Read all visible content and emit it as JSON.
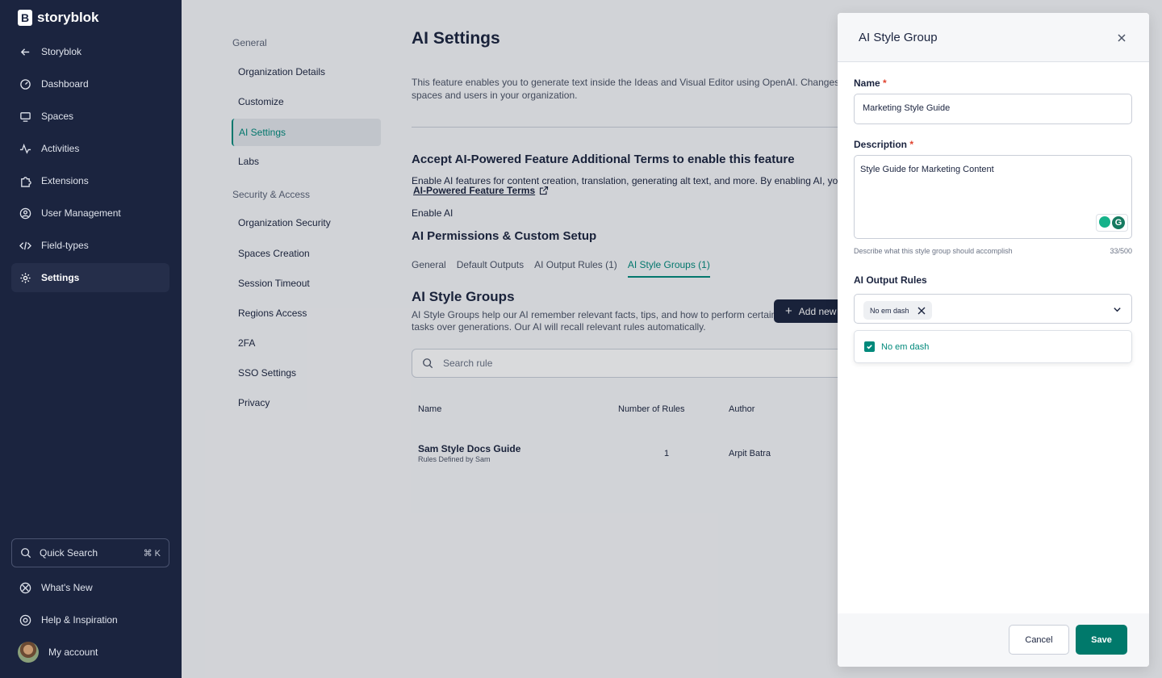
{
  "nav": {
    "brand": "storyblok",
    "items": [
      {
        "label": "Storyblok",
        "icon": "arrow-left-icon"
      },
      {
        "label": "Dashboard",
        "icon": "gauge-icon"
      },
      {
        "label": "Spaces",
        "icon": "monitor-icon"
      },
      {
        "label": "Activities",
        "icon": "activity-icon"
      },
      {
        "label": "Extensions",
        "icon": "puzzle-icon"
      },
      {
        "label": "User Management",
        "icon": "user-circle-icon"
      },
      {
        "label": "Field-types",
        "icon": "code-icon"
      },
      {
        "label": "Settings",
        "icon": "gear-icon"
      }
    ],
    "quick_search": "Quick Search",
    "quick_search_shortcut": "⌘ K",
    "whats_new": "What's New",
    "help": "Help & Inspiration",
    "account": "My account"
  },
  "settings_menu": {
    "general_heading": "General",
    "general_items": [
      "Organization Details",
      "Customize",
      "AI Settings",
      "Labs"
    ],
    "security_heading": "Security & Access",
    "security_items": [
      "Organization Security",
      "Spaces Creation",
      "Session Timeout",
      "Regions Access",
      "2FA",
      "SSO Settings",
      "Privacy"
    ]
  },
  "page": {
    "title": "AI Settings",
    "intro_line1": "This feature enables you to generate text inside the Ideas and Visual Editor using OpenAI. Changes here aff",
    "intro_line2": "spaces and users in your organization.",
    "terms_heading": "Accept AI-Powered Feature Additional Terms to enable this feature",
    "terms_text": "Enable AI features for content creation, translation, generating alt text, and more. By enabling AI, you conse",
    "terms_link": "AI-Powered Feature Terms",
    "enable_ai": "Enable AI",
    "permissions_heading": "AI Permissions & Custom Setup",
    "tabs": [
      "General",
      "Default Outputs",
      "AI Output Rules (1)",
      "AI Style Groups (1)"
    ],
    "groups_heading": "AI Style Groups",
    "groups_desc1": "AI Style Groups help our AI remember relevant facts, tips, and how to perform certain",
    "groups_desc2": "tasks over generations. Our AI will recall relevant rules automatically.",
    "add_new": "Add new",
    "search_placeholder": "Search rule",
    "table": {
      "headers": [
        "Name",
        "Number of Rules",
        "Author"
      ],
      "rows": [
        {
          "name": "Sam Style Docs Guide",
          "sub": "Rules Defined by Sam",
          "rules": "1",
          "author": "Arpit Batra"
        }
      ]
    }
  },
  "drawer": {
    "title": "AI Style Group",
    "name_label": "Name",
    "name_value": "Marketing Style Guide",
    "description_label": "Description",
    "description_value": "Style Guide for Marketing Content",
    "description_helper": "Describe what this style group should accomplish",
    "description_count": "33/500",
    "rules_label": "AI Output Rules",
    "selected_chip": "No em dash",
    "options": [
      {
        "label": "No em dash",
        "checked": true
      }
    ],
    "cancel": "Cancel",
    "save": "Save"
  },
  "colors": {
    "nav_bg": "#1b243f",
    "accent": "#00897b",
    "save": "#00796b",
    "required": "#e0432f"
  }
}
